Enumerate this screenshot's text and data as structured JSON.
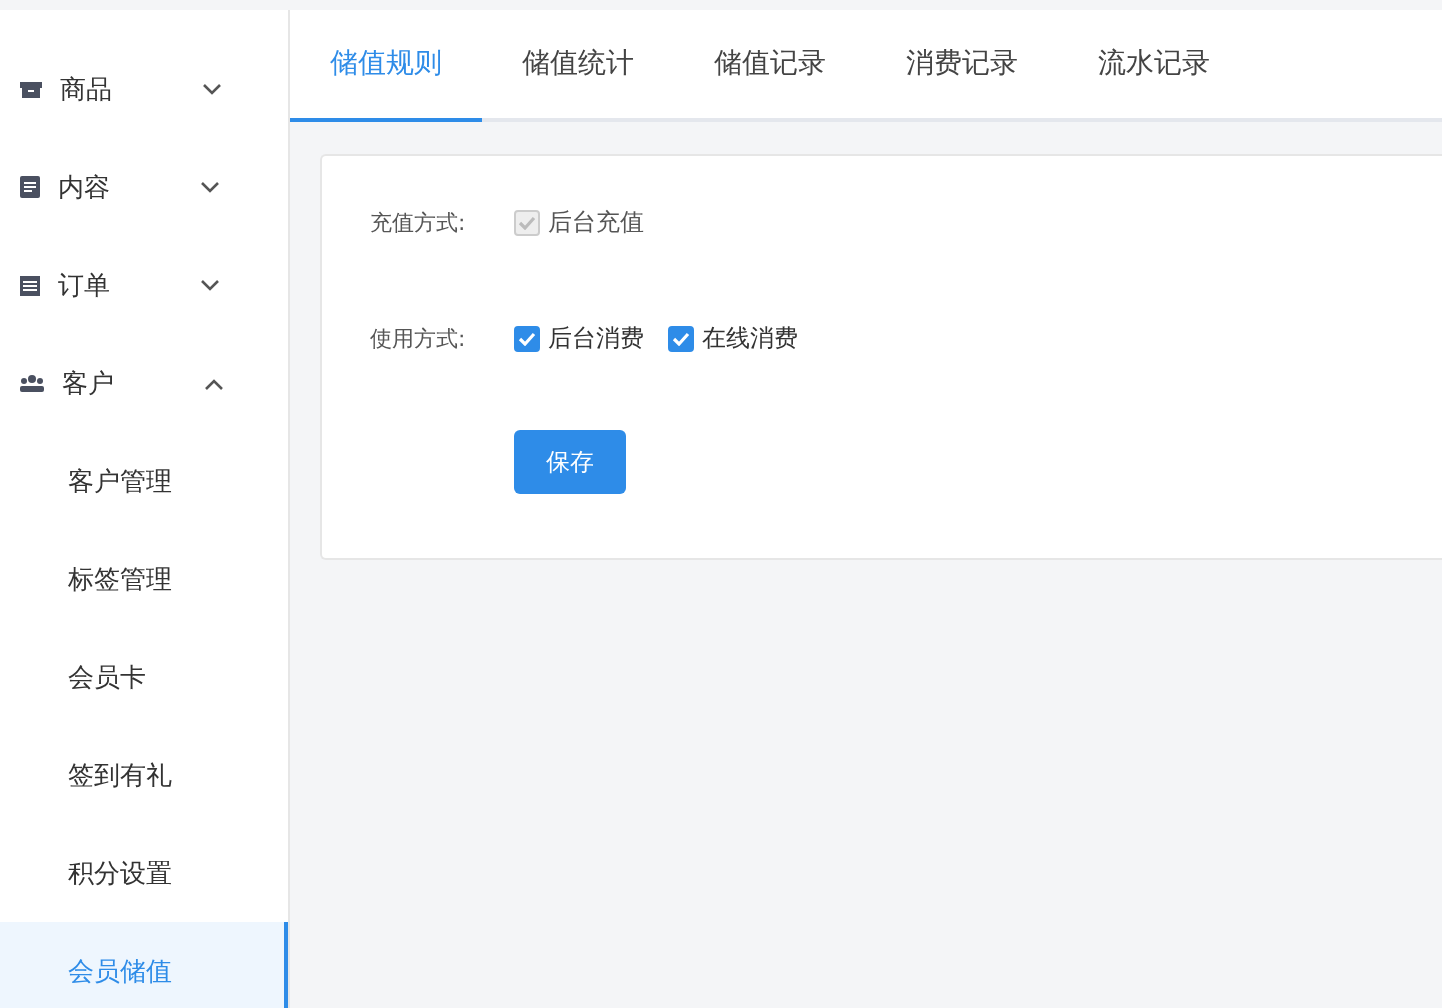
{
  "sidebar": {
    "groups": [
      {
        "label": "商品",
        "expanded": false
      },
      {
        "label": "内容",
        "expanded": false
      },
      {
        "label": "订单",
        "expanded": false
      },
      {
        "label": "客户",
        "expanded": true,
        "items": [
          {
            "label": "客户管理",
            "selected": false
          },
          {
            "label": "标签管理",
            "selected": false
          },
          {
            "label": "会员卡",
            "selected": false
          },
          {
            "label": "签到有礼",
            "selected": false
          },
          {
            "label": "积分设置",
            "selected": false
          },
          {
            "label": "会员储值",
            "selected": true
          }
        ]
      }
    ]
  },
  "tabs": [
    {
      "label": "储值规则",
      "selected": true
    },
    {
      "label": "储值统计",
      "selected": false
    },
    {
      "label": "储值记录",
      "selected": false
    },
    {
      "label": "消费记录",
      "selected": false
    },
    {
      "label": "流水记录",
      "selected": false
    }
  ],
  "form": {
    "rows": [
      {
        "label": "充值方式:",
        "options": [
          {
            "label": "后台充值",
            "checked": true,
            "disabled": true
          }
        ]
      },
      {
        "label": "使用方式:",
        "options": [
          {
            "label": "后台消费",
            "checked": true,
            "disabled": false
          },
          {
            "label": "在线消费",
            "checked": true,
            "disabled": false
          }
        ]
      }
    ],
    "button": "保存"
  }
}
